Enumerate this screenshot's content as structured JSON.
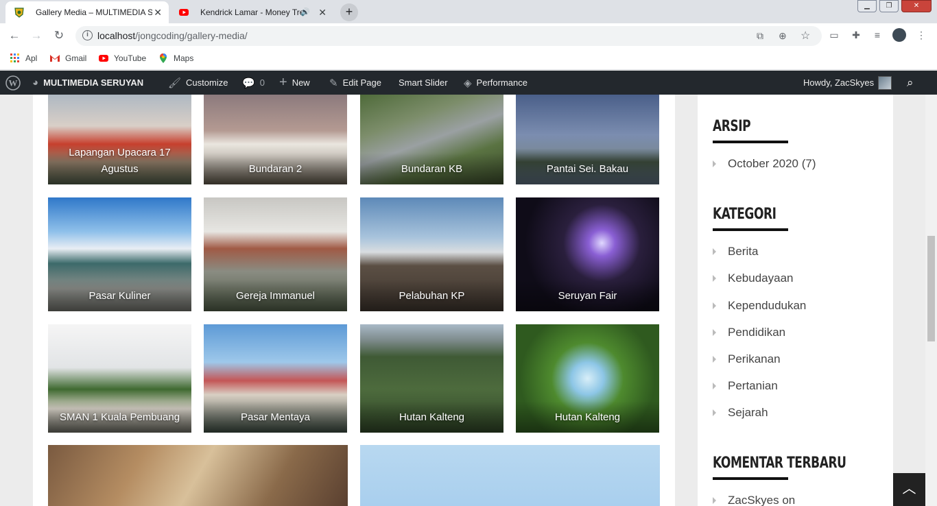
{
  "browser": {
    "tabs": [
      {
        "title": "Gallery Media – MULTIMEDIA SER",
        "active": true
      },
      {
        "title": "Kendrick Lamar - Money Tree",
        "active": false
      }
    ],
    "url_host": "localhost",
    "url_path": "/jongcoding/gallery-media/",
    "bookmarks": [
      "Apl",
      "Gmail",
      "YouTube",
      "Maps"
    ]
  },
  "adminbar": {
    "site_name": "MULTIMEDIA SERUYAN",
    "customize": "Customize",
    "comments_count": "0",
    "new": "New",
    "edit_page": "Edit Page",
    "smart_slider": "Smart Slider",
    "performance": "Performance",
    "howdy": "Howdy, ZacSkyes"
  },
  "gallery": {
    "row1": [
      "Lapangan Upacara 17 Agustus",
      "Bundaran 2",
      "Bundaran KB",
      "Pantai Sei. Bakau"
    ],
    "row2": [
      "Pasar Kuliner",
      "Gereja Immanuel",
      "Pelabuhan KP",
      "Seruyan Fair"
    ],
    "row3": [
      "SMAN 1 Kuala Pembuang",
      "Pasar Mentaya",
      "Hutan Kalteng",
      "Hutan Kalteng"
    ]
  },
  "sidebar": {
    "arsip_title": "ARSIP",
    "arsip_items": [
      "October 2020 (7)"
    ],
    "kategori_title": "KATEGORI",
    "kategori_items": [
      "Berita",
      "Kebudayaan",
      "Kependudukan",
      "Pendidikan",
      "Perikanan",
      "Pertanian",
      "Sejarah"
    ],
    "komentar_title": "KOMENTAR TERBARU",
    "komentar_items": [
      "ZacSkyes on"
    ]
  }
}
